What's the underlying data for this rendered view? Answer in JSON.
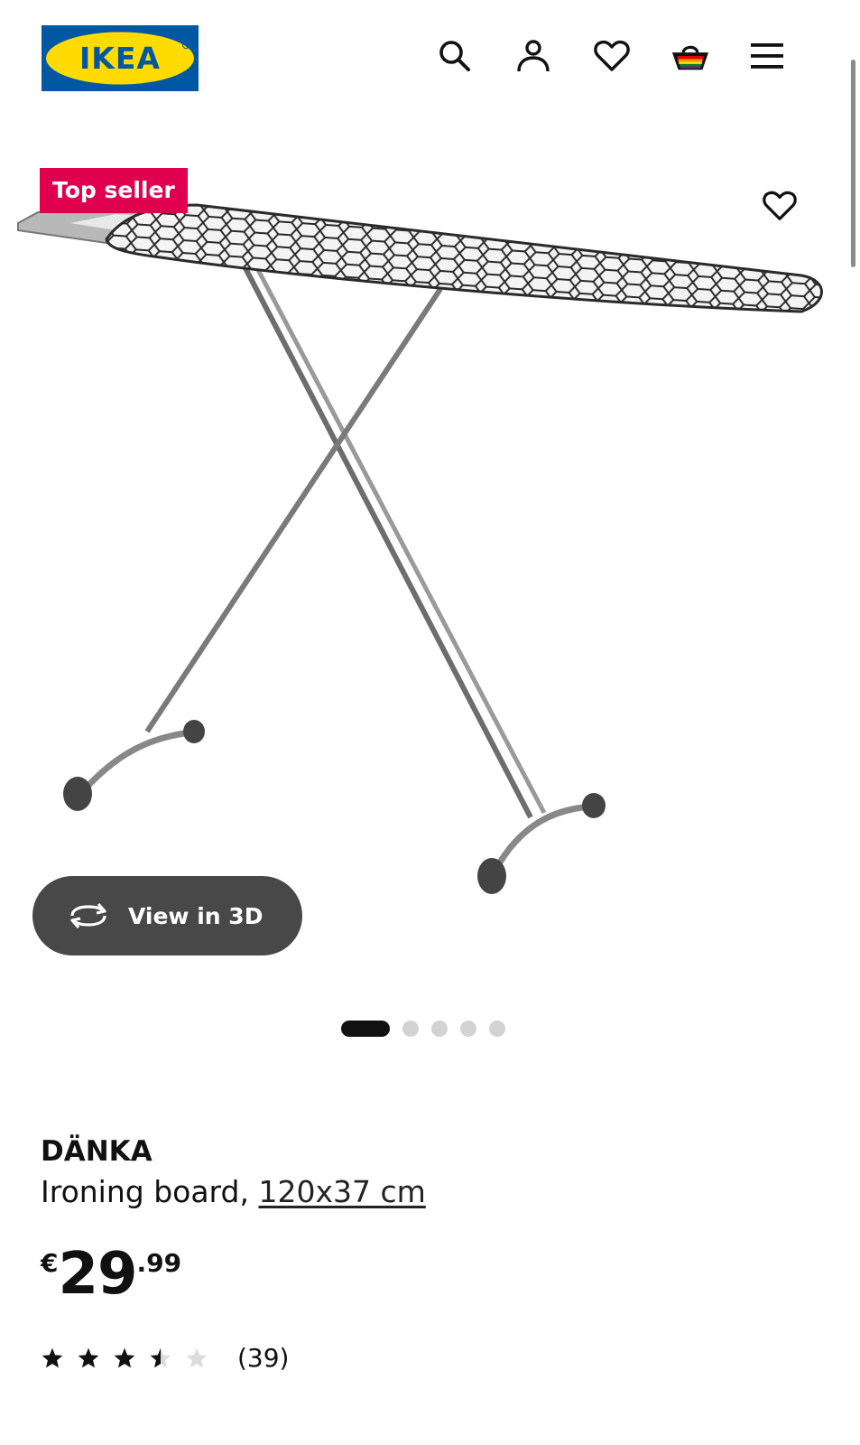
{
  "header": {
    "logo_text": "IKEA",
    "logo_colors": {
      "background": "#0058a3",
      "oval": "#ffdb00",
      "text": "#0058a3"
    },
    "icons": [
      "search-icon",
      "account-icon",
      "favourites-icon",
      "shopping-basket-icon",
      "menu-icon"
    ]
  },
  "gallery": {
    "badge": "Top seller",
    "badge_color": "#e0004d",
    "view_3d_label": "View in 3D",
    "image_count": 5,
    "active_index": 0
  },
  "product": {
    "name": "DÄNKA",
    "type": "Ironing board,",
    "dimensions": "120x37 cm",
    "price": {
      "currency": "€",
      "integer": "29",
      "decimal": ".99"
    },
    "rating": {
      "value": 3.5,
      "max": 5,
      "count_label": "(39)"
    }
  }
}
